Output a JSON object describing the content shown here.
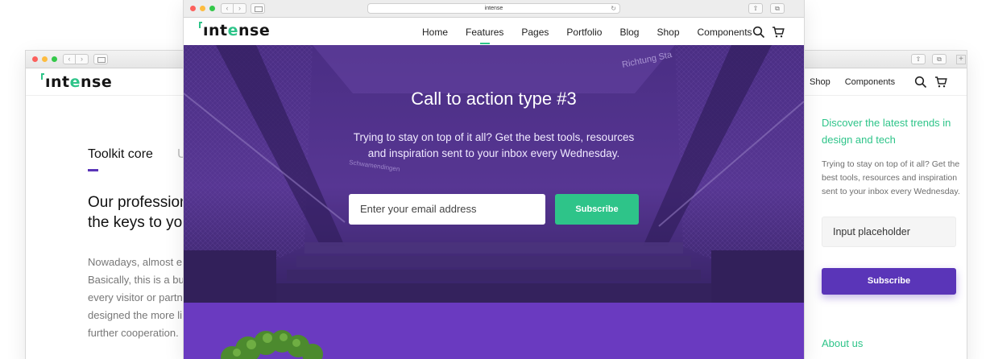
{
  "brand": {
    "logo_prefix": "ınt",
    "logo_accent": "e",
    "logo_suffix": "nse",
    "accent_color": "#2ec489",
    "purple_color": "#5a35b8"
  },
  "browser_front": {
    "address": "intense"
  },
  "nav": {
    "items": [
      "Home",
      "Features",
      "Pages",
      "Portfolio",
      "Blog",
      "Shop",
      "Components"
    ],
    "active": "Features",
    "search_icon": "search-icon",
    "cart_icon": "cart-icon"
  },
  "nav_back_right": {
    "items": [
      "Shop",
      "Components"
    ]
  },
  "left_page": {
    "tabs": [
      "Toolkit core",
      "U"
    ],
    "heading_lines": [
      "Our profession",
      "the keys to yo"
    ],
    "body_lines": [
      "Nowadays, almost e",
      "Basically, this is a bu",
      "every visitor or partn",
      "designed the more li",
      "further cooperation."
    ]
  },
  "hero": {
    "title": "Call to action type #3",
    "subtitle_line1": "Trying to stay on top of it all? Get the best tools, resources",
    "subtitle_line2": "and inspiration sent to your inbox every Wednesday.",
    "email_placeholder": "Enter your email address",
    "subscribe_label": "Subscribe",
    "sign1": "Richtung Sta",
    "sign2": "Schwamendingen"
  },
  "sidebar": {
    "title": "Discover the latest trends in design and tech",
    "text": "Trying to stay on top of it all? Get the best tools, resources and inspiration sent to your inbox every Wednesday.",
    "input_placeholder": "Input placeholder",
    "subscribe_label": "Subscribe",
    "about_label": "About us"
  }
}
